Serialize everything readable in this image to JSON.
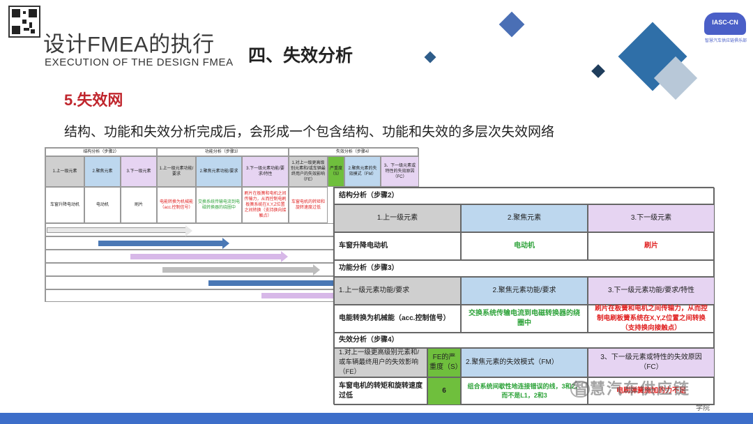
{
  "header": {
    "title": "设计FMEA的执行",
    "subtitle": "EXECUTION OF THE DESIGN FMEA",
    "section": "四、失效分析",
    "logo_text": "IASC-CN",
    "logo_caption": "智慧汽车供应链俱乐部"
  },
  "heading": "5.失效网",
  "intro": "结构、功能和失效分析完成后，会形成一个包含结构、功能和失效的多层次失效网络",
  "back_table": {
    "group_headers": [
      "结构分析（步骤2）",
      "功能分析（步骤3）",
      "失效分析（步骤4）"
    ],
    "col_headers": [
      "1.上一级元素",
      "2.聚焦元素",
      "3.下一级元素",
      "1.上一级元素功能/要求",
      "2.聚焦元素功能/要求",
      "3.下一级元素功能/要求/特性",
      "1.对上一级更高级别元素和/或车辆最终用户的失效影响（FE）",
      "严重度（S）",
      "2.聚焦元素的失效模式（FM）",
      "3、下一级元素或特性的失效原因（FC）"
    ],
    "row": [
      "车窗升降电动机",
      "电动机",
      "刷片",
      "电能转换为机械能（acc.控制信号）",
      "交换系统传输电流到电磁转换器的绕圈中",
      "刷片在板簧和电机之间传输力，从而控制电刷板簧系统在X,Y,Z位置之间转换（支持换向接触点）",
      "车窗电机的转矩和旋转速度过低"
    ]
  },
  "front_table": {
    "structure": {
      "title": "结构分析（步骤2）",
      "headers": [
        "1.上一级元素",
        "2.聚焦元素",
        "3.下一级元素"
      ],
      "values": [
        "车窗升降电动机",
        "电动机",
        "刷片"
      ]
    },
    "function": {
      "title": "功能分析（步骤3）",
      "headers": [
        "1.上一级元素功能/要求",
        "2.聚焦元素功能/要求",
        "3.下一级元素功能/要求/特性"
      ],
      "values": [
        "电能转换为机械能（acc.控制信号）",
        "交换系统传输电流到电磁转换器的绕圈中",
        "刷片在板簧和电机之间传输力，从而控制电刷板簧系统在X,Y,Z位置之间转换（支持换向接触点）"
      ]
    },
    "failure": {
      "title": "失效分析（步骤4）",
      "headers": [
        "1.对上一级更高级别元素和/或车辆最终用户的失效影响（FE）",
        "FE的严重度（S）",
        "2.聚焦元素的失效模式（FM）",
        "3、下一级元素或特性的失效原因（FC）"
      ],
      "values": [
        "车窗电机的转矩和旋转速度过低",
        "6",
        "组合系统间歇性地连接错误的线，3和2，而不是L1，2和3",
        "电刷弹簧施加的力不足"
      ]
    }
  },
  "watermark": "智慧汽车供应链",
  "watermark_small": "学院",
  "colors": {
    "accent_red": "#c0262d",
    "bar_blue": "#3d6ec9",
    "header_grey": "#cfcfcf",
    "header_blue": "#bdd7ee",
    "header_violet": "#e6d4f2",
    "severity_green": "#6fbf3d"
  }
}
